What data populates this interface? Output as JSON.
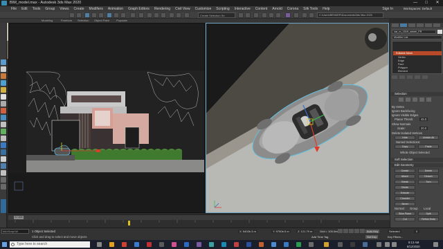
{
  "window": {
    "title": "BIM_model.max - Autodesk 3ds Max 2020",
    "controls": [
      "—",
      "□",
      "✕"
    ]
  },
  "menu": [
    "File",
    "Edit",
    "Tools",
    "Group",
    "Views",
    "Create",
    "Modifiers",
    "Animation",
    "Graph Editors",
    "Rendering",
    "Civil View",
    "Customize",
    "Scripting",
    "Interactive",
    "Content",
    "Arnold",
    "Corona",
    "Silk Tools",
    "Help"
  ],
  "signin": "Sign In",
  "workspace": "Workspaces: Default",
  "toolbar": {
    "selection_set": "Create Selection Se",
    "path": "C:\\Users\\BENDER\\Documents\\3ds Max 2020"
  },
  "ribbon_row": [
    "Modeling",
    "Freeform",
    "Selection",
    "Object Paint",
    "Populate"
  ],
  "viewport_left": {
    "label": "[+] [Front] [Standard] [Default Shading]"
  },
  "viewport_right": {
    "label": "[+] [Perspective] [Standard] [Default Shading]"
  },
  "command_panel": {
    "object_name": "car_m_1519_wheel_FR",
    "modifier_list": "Modifier List",
    "stack": [
      "Editable Mesh",
      "Vertex",
      "Edge",
      "Face",
      "Polygon",
      "Element"
    ],
    "selection": {
      "title": "Selection",
      "by_vertex": "By Vertex",
      "ignore_backfacing": "Ignore Backfacing",
      "ignore_visible_edges": "Ignore Visible Edges",
      "planar_thresh_label": "Planar Thresh:",
      "planar_thresh_value": "45.0",
      "show_normals": "Show Normals",
      "scale_label": "Scale:",
      "scale_value": "20.0",
      "delete_isolated": "Delete Isolated Vertices",
      "hide": "Hide",
      "unhide_all": "Unhide All",
      "named_selections": "Named Selections:",
      "copy": "Copy",
      "paste": "Paste",
      "whole_object_selected": "Whole Object Selected"
    },
    "soft_selection": "Soft Selection",
    "edit_geometry": {
      "title": "Edit Geometry",
      "buttons": [
        "Create",
        "Delete",
        "Attach",
        "Detach",
        "Break",
        "Turn",
        "Divide",
        "Extrude",
        "Chamfer",
        "Bevel",
        "Normal:",
        "Group",
        "Local",
        "Slice Plane",
        "Split",
        "Cut",
        "Refine Ends",
        "Weld",
        "Selected",
        "Target",
        "Tessellate",
        "Explode"
      ]
    }
  },
  "timeline": {
    "slider": "0 / 100",
    "ticks": [
      "0",
      "5",
      "10",
      "15",
      "20",
      "25",
      "30",
      "35",
      "40",
      "45",
      "50",
      "55",
      "60",
      "65",
      "70",
      "75",
      "80",
      "85",
      "90",
      "95",
      "100"
    ]
  },
  "status": {
    "selected": "1 Object Selected",
    "prompt": "Click and drag to select and move objects",
    "maxscript": "MAXScript Mi",
    "x": "X: 5402b.3 m",
    "y": "Y: 9750b.5 m",
    "z": "Z: 121.79 m",
    "grid": "Grid = 100.0mm",
    "add_time_tag": "Add Time Tag",
    "auto_key": "Auto Key",
    "selected_btn": "Selected",
    "set_key": "Set Key",
    "key_filters": "Key Filters...",
    "frame": "0"
  },
  "taskbar": {
    "search_placeholder": "Type here to search",
    "time": "8:13 AM",
    "date": "8/12/2020"
  },
  "colors": {
    "accent": "#6fa8c8",
    "selection_red": "#c0392b",
    "stack_highlight": "#b84a2a"
  }
}
